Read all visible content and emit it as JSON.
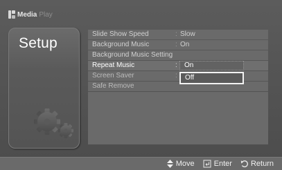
{
  "header": {
    "brand_strong": "Media",
    "brand_light": "Play"
  },
  "panel": {
    "title": "Setup",
    "icon": "gears-icon"
  },
  "menu": {
    "items": [
      {
        "label": "Slide Show Speed",
        "separator": ":",
        "value": "Slow"
      },
      {
        "label": "Background Music",
        "separator": ":",
        "value": "On"
      },
      {
        "label": "Background Music Setting",
        "separator": "",
        "value": ""
      },
      {
        "label": "Repeat Music",
        "separator": ":",
        "value": ""
      },
      {
        "label": "Screen Saver",
        "separator": ":",
        "value": ""
      },
      {
        "label": "Safe Remove",
        "separator": "",
        "value": ""
      }
    ]
  },
  "dropdown": {
    "options": [
      {
        "label": "On"
      },
      {
        "label": "Off"
      }
    ],
    "selected_label": "Off"
  },
  "footer": {
    "hints": [
      {
        "icon": "updown-arrows-icon",
        "label": "Move"
      },
      {
        "icon": "enter-icon",
        "label": "Enter"
      },
      {
        "icon": "return-icon",
        "label": "Return"
      }
    ]
  }
}
